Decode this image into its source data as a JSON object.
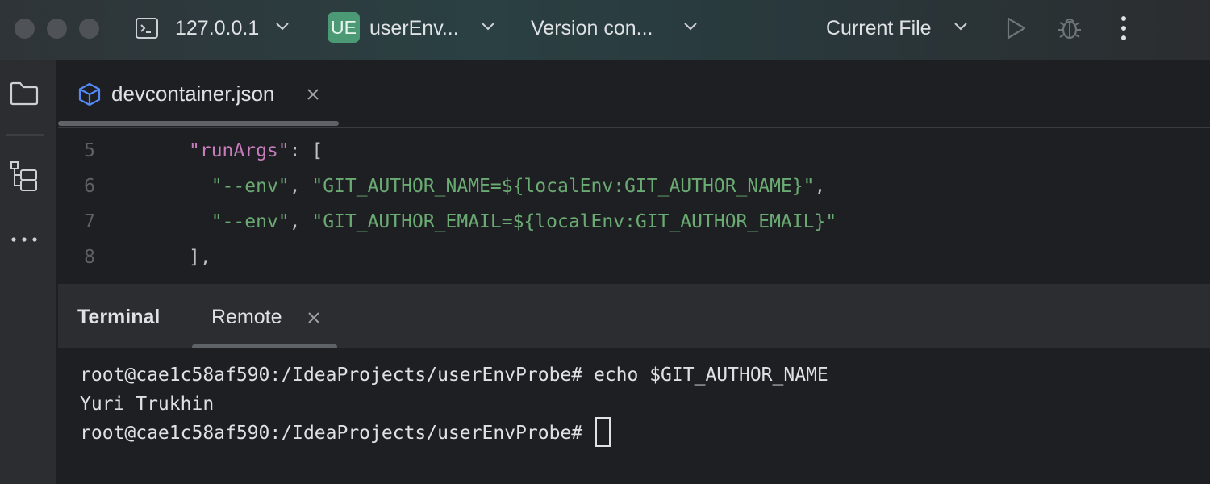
{
  "titlebar": {
    "ssh_host": "127.0.0.1",
    "project_badge": "UE",
    "project_name": "userEnv...",
    "vcs_label": "Version con...",
    "run_config": "Current File"
  },
  "editor": {
    "tab_filename": "devcontainer.json",
    "lines": [
      {
        "num": "5",
        "parts": [
          {
            "t": "\"runArgs\"",
            "c": "key"
          },
          {
            "t": ": [",
            "c": "plain"
          }
        ]
      },
      {
        "num": "6",
        "parts": [
          {
            "t": "  ",
            "c": "plain"
          },
          {
            "t": "\"--env\"",
            "c": "str"
          },
          {
            "t": ", ",
            "c": "plain"
          },
          {
            "t": "\"GIT_AUTHOR_NAME=${localEnv:GIT_AUTHOR_NAME}\"",
            "c": "str"
          },
          {
            "t": ",",
            "c": "plain"
          }
        ]
      },
      {
        "num": "7",
        "parts": [
          {
            "t": "  ",
            "c": "plain"
          },
          {
            "t": "\"--env\"",
            "c": "str"
          },
          {
            "t": ", ",
            "c": "plain"
          },
          {
            "t": "\"GIT_AUTHOR_EMAIL=${localEnv:GIT_AUTHOR_EMAIL}\"",
            "c": "str"
          }
        ]
      },
      {
        "num": "8",
        "parts": [
          {
            "t": "],",
            "c": "plain"
          }
        ]
      }
    ]
  },
  "terminal": {
    "title": "Terminal",
    "tab_label": "Remote",
    "lines": [
      "root@cae1c58af590:/IdeaProjects/userEnvProbe# echo $GIT_AUTHOR_NAME",
      "Yuri Trukhin"
    ],
    "prompt": "root@cae1c58af590:/IdeaProjects/userEnvProbe# "
  },
  "colors": {
    "keyword": "#c77dbb",
    "string": "#6aab73",
    "badge": "#4b9a75"
  },
  "icons": [
    "terminal-icon",
    "chevron-down-icon",
    "run-icon",
    "debug-icon",
    "more-vertical-icon",
    "folder-icon",
    "structure-icon",
    "more-horizontal-icon",
    "json-cube-icon",
    "close-icon"
  ]
}
